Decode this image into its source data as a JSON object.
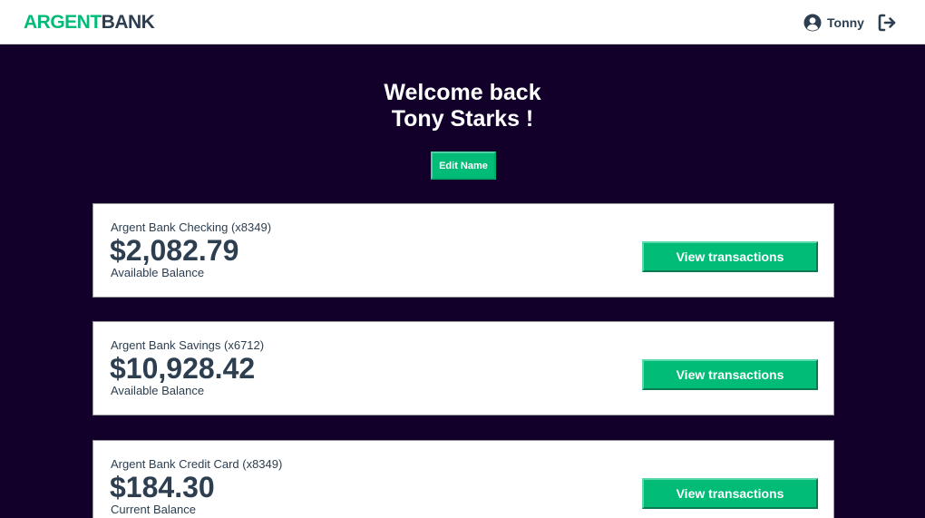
{
  "brand": {
    "logo_part1": "ARGENT",
    "logo_part2": "BANK",
    "accent_color": "#00bc77",
    "dark_color": "#2c3e50",
    "background_color": "#12002b"
  },
  "nav": {
    "user_name": "Tonny",
    "user_icon": "user-circle-icon",
    "signout_icon": "sign-out-icon"
  },
  "header": {
    "welcome_line1": "Welcome back",
    "welcome_line2": "Tony Starks !",
    "edit_button_label": "Edit Name"
  },
  "accounts": [
    {
      "title": "Argent Bank Checking (x8349)",
      "amount": "$2,082.79",
      "description": "Available Balance",
      "button_label": "View transactions"
    },
    {
      "title": "Argent Bank Savings (x6712)",
      "amount": "$10,928.42",
      "description": "Available Balance",
      "button_label": "View transactions"
    },
    {
      "title": "Argent Bank Credit Card (x8349)",
      "amount": "$184.30",
      "description": "Current Balance",
      "button_label": "View transactions"
    }
  ]
}
